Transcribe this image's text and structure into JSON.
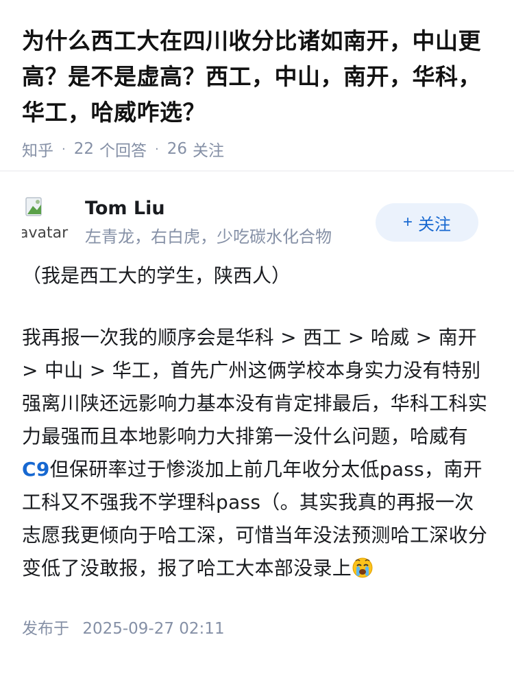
{
  "question": {
    "title": "为什么西工大在四川收分比诸如南开，中山更高？是不是虚高？西工，中山，南开，华科，华工，哈威咋选？",
    "source": "知乎",
    "answer_count": "22",
    "answer_label": "个回答",
    "follow_count": "26",
    "follow_label": "关注"
  },
  "answer": {
    "author": {
      "name": "Tom Liu",
      "bio": "左青龙，右白虎，少吃碳水化合物",
      "avatar_alt": "avatar"
    },
    "follow_button": {
      "icon": "+",
      "label": "关注"
    },
    "intro": "（我是西工大的学生，陕西人）",
    "body_before_link": "我再报一次我的顺序会是华科 > 西工 > 哈威 > 南开 > 中山 > 华工，首先广州这俩学校本身实力没有特别强离川陕还远影响力基本没有肯定排最后，华科工科实力最强而且本地影响力大排第一没什么问题，哈威有",
    "keyword_link": "C9",
    "body_after_link": "但保研率过于惨淡加上前几年收分太低pass，南开工科又不强我不学理科pass（。其实我真的再报一次志愿我更倾向于哈工深，可惜当年没法预测哈工深收分变低了没敢报，报了哈工大本部没录上",
    "emoji": "crying-face-emoji",
    "publish_label": "发布于",
    "publish_time": "2025-09-27 02:11"
  },
  "colors": {
    "accent": "#1768d1",
    "follow_bg": "#ebf2fc",
    "meta_text": "#8590a6",
    "title_text": "#121212"
  }
}
